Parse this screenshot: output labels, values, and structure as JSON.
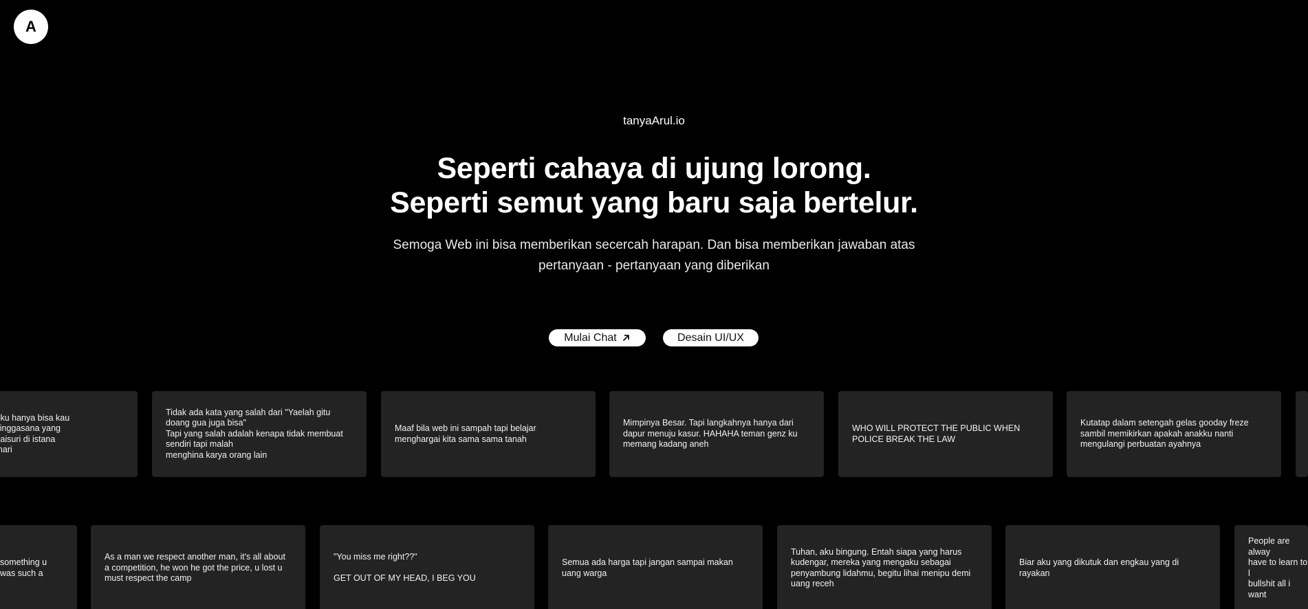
{
  "logo": {
    "letter": "A"
  },
  "brand": "tanyaArul.io",
  "headline": {
    "line1": "Seperti cahaya di ujung lorong.",
    "line2": "Seperti semut yang baru saja bertelur."
  },
  "subtitle": "Semoga Web ini bisa memberikan secercah harapan. Dan bisa memberikan jawaban atas pertanyaan - pertanyaan yang diberikan",
  "buttons": {
    "chat_label": "Mulai Chat",
    "design_label": "Desain UI/UX"
  },
  "row1": [
    "a segala tentangku hanya bisa kau\nama. Ingat lagi singgasana yang\nati sebagai permaisuri di istana\n selama ratusan hari",
    "Tidak ada kata yang salah dari \"Yaelah gitu doang gua juga bisa\"\nTapi yang salah adalah kenapa tidak membuat sendiri tapi malah\nmenghina karya orang lain",
    "Maaf bila web ini sampah tapi belajar menghargai kita sama sama tanah",
    "Mimpinya Besar. Tapi langkahnya hanya dari dapur menuju kasur. HAHAHA teman genz ku memang kadang aneh",
    "WHO WILL PROTECT THE PUBLIC WHEN POLICE BREAK THE LAW",
    "Kutatap dalam setengah gelas gooday freze sambil memikirkan apakah anakku nanti mengulangi perbuatan ayahnya",
    ""
  ],
  "row2": [
    "something u\nwas such a",
    "As a man we respect another man, it's all about a competition, he won he got the price, u lost u must respect the camp",
    "\"You miss me right??\"\n\nGET OUT OF MY HEAD, I BEG YOU",
    "Semua ada harga tapi jangan sampai makan uang warga",
    "Tuhan, aku bingung. Entah siapa yang harus kudengar, mereka yang mengaku sebagai penyambung lidahmu, begitu lihai menipu demi uang receh",
    "Biar aku yang dikutuk dan engkau yang di rayakan",
    "People are alway\nhave to learn to l\nbullshit all i want"
  ]
}
